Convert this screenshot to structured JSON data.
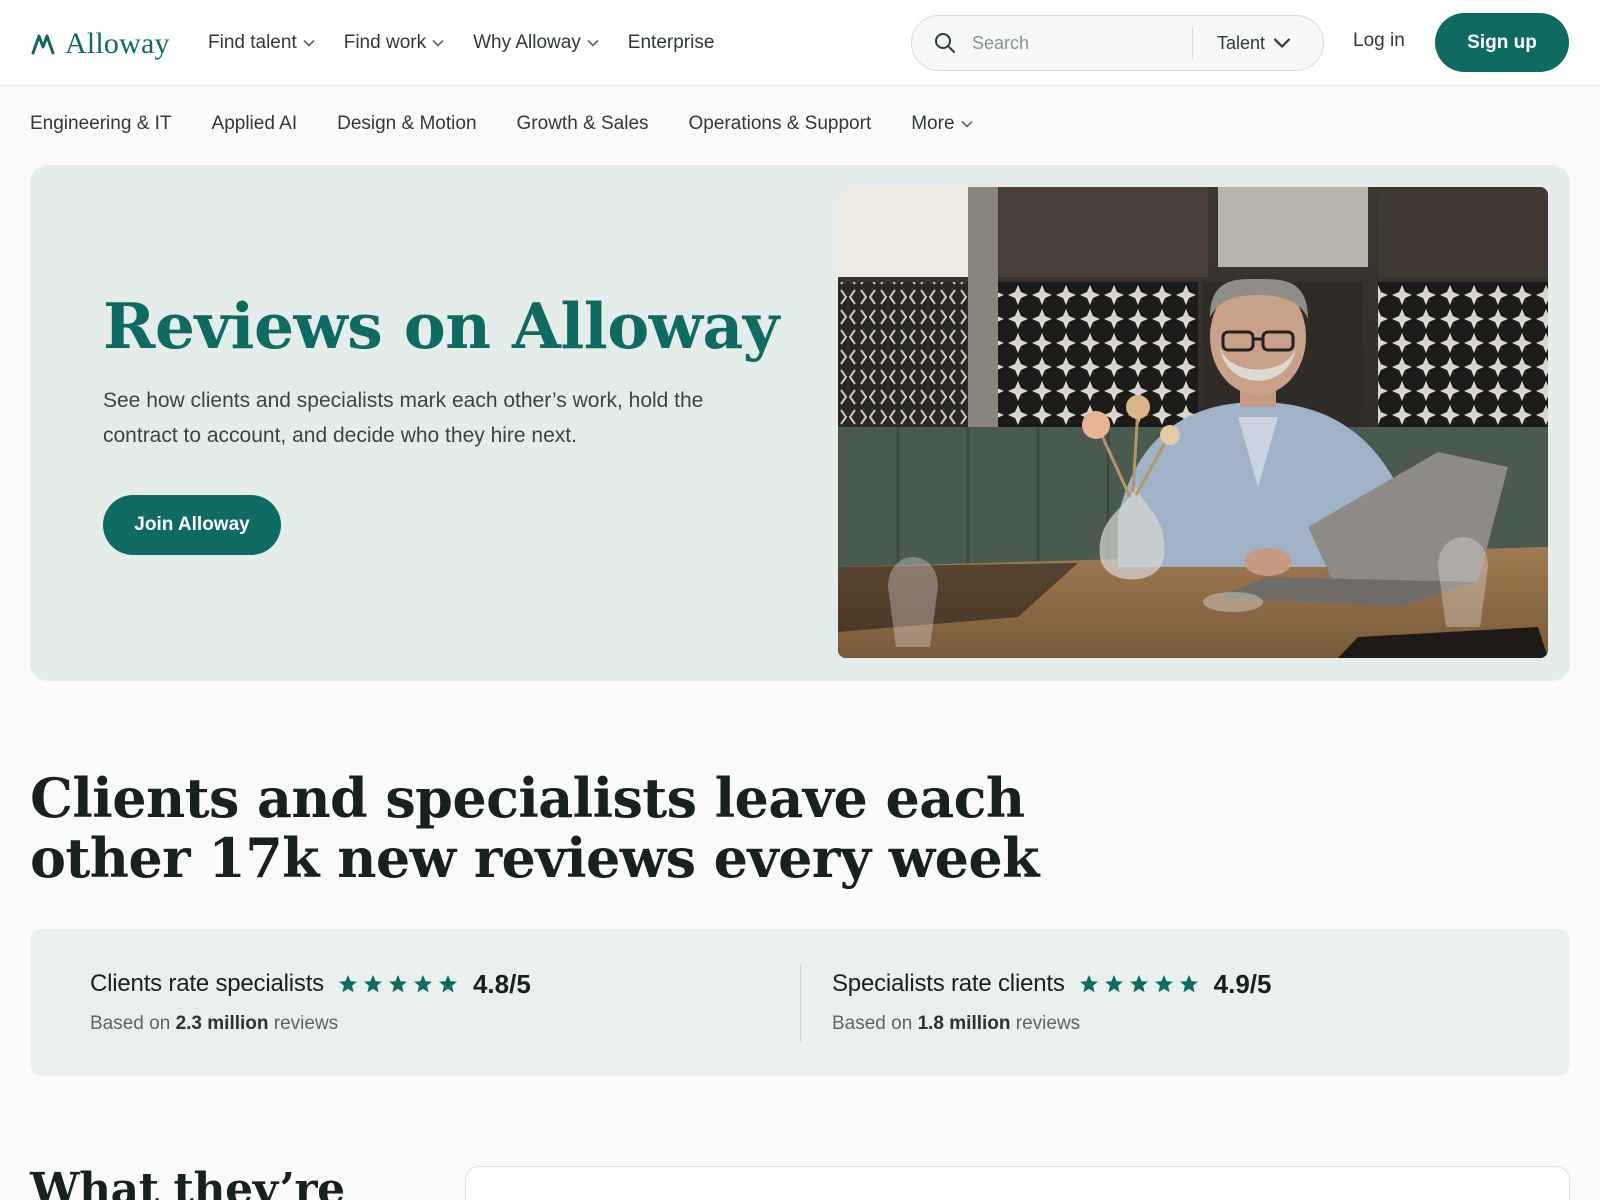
{
  "header": {
    "logo_text": "Alloway",
    "nav": [
      {
        "label": "Find talent",
        "has_menu": true
      },
      {
        "label": "Find work",
        "has_menu": true
      },
      {
        "label": "Why Alloway",
        "has_menu": true
      },
      {
        "label": "Enterprise",
        "has_menu": false
      }
    ],
    "search": {
      "placeholder": "Search",
      "scope": "Talent"
    },
    "login_label": "Log in",
    "signup_label": "Sign up",
    "brand_color": "#0f6b62"
  },
  "categories": [
    "Engineering & IT",
    "Applied AI",
    "Design & Motion",
    "Growth & Sales",
    "Operations & Support",
    "More"
  ],
  "hero": {
    "title": "Reviews on Alloway",
    "subtitle": "See how clients and specialists mark each other’s work, hold the contract to account, and decide who they hire next.",
    "cta_label": "Join Alloway",
    "image_description_icon": "photo-man-with-laptop"
  },
  "stats": {
    "headline_line1": "Clients and specialists leave each",
    "headline_line2": "other 17k new reviews every week",
    "ratings": [
      {
        "label": "Clients rate specialists",
        "stars": 5,
        "score": "4.8/5",
        "basis_prefix": "Based on",
        "basis_count": "2.3 million",
        "basis_suffix": "reviews"
      },
      {
        "label": "Specialists rate clients",
        "stars": 5,
        "score": "4.9/5",
        "basis_prefix": "Based on",
        "basis_count": "1.8 million",
        "basis_suffix": "reviews"
      }
    ]
  },
  "testimonials": {
    "heading_partial": "What they’re"
  }
}
